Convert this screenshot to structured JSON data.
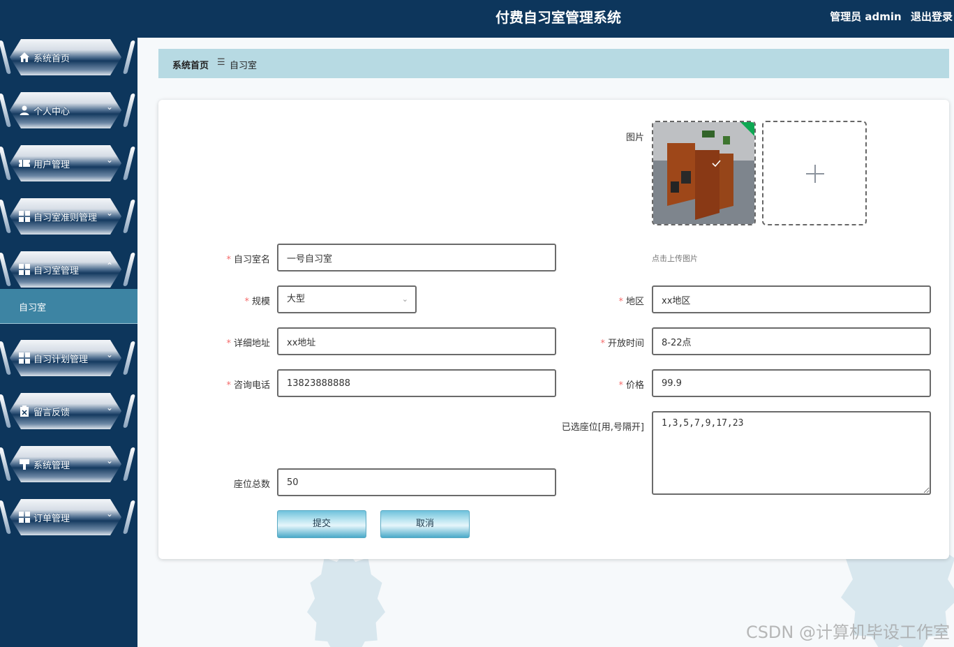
{
  "header": {
    "title": "付费自习室管理系统",
    "user": "管理员 admin",
    "logout": "退出登录"
  },
  "sidebar": {
    "items": [
      {
        "label": "系统首页",
        "icon": "home-icon"
      },
      {
        "label": "个人中心",
        "icon": "user-icon"
      },
      {
        "label": "用户管理",
        "icon": "ticket-icon"
      },
      {
        "label": "自习室准则管理",
        "icon": "grid-icon"
      },
      {
        "label": "自习室管理",
        "icon": "grid-icon",
        "expanded": true
      },
      {
        "label": "自习计划管理",
        "icon": "grid-icon"
      },
      {
        "label": "留言反馈",
        "icon": "clipboard-icon"
      },
      {
        "label": "系统管理",
        "icon": "pin-icon"
      },
      {
        "label": "订单管理",
        "icon": "grid-icon"
      }
    ],
    "active_sub": "自习室"
  },
  "breadcrumb": {
    "home": "系统首页",
    "separator": "☰",
    "current": "自习室"
  },
  "form": {
    "image": {
      "label": "图片",
      "hint": "点击上传图片"
    },
    "name": {
      "label": "自习室名",
      "value": "一号自习室"
    },
    "size": {
      "label": "规模",
      "value": "大型"
    },
    "region": {
      "label": "地区",
      "value": "xx地区"
    },
    "address": {
      "label": "详细地址",
      "value": "xx地址"
    },
    "hours": {
      "label": "开放时间",
      "value": "8-22点"
    },
    "phone": {
      "label": "咨询电话",
      "value": "13823888888"
    },
    "price": {
      "label": "价格",
      "value": "99.9"
    },
    "selected_seats": {
      "label": "已选座位[用,号隔开]",
      "value": "1,3,5,7,9,17,23"
    },
    "total_seats": {
      "label": "座位总数",
      "value": "50"
    },
    "submit": "提交",
    "cancel": "取消"
  },
  "watermark": "CSDN @计算机毕设工作室",
  "colors": {
    "sidebar_bg": "#0d365c",
    "active_sub_bg": "#3d84a3",
    "breadcrumb_bg": "#b7dae3",
    "required": "#f56c6c"
  }
}
